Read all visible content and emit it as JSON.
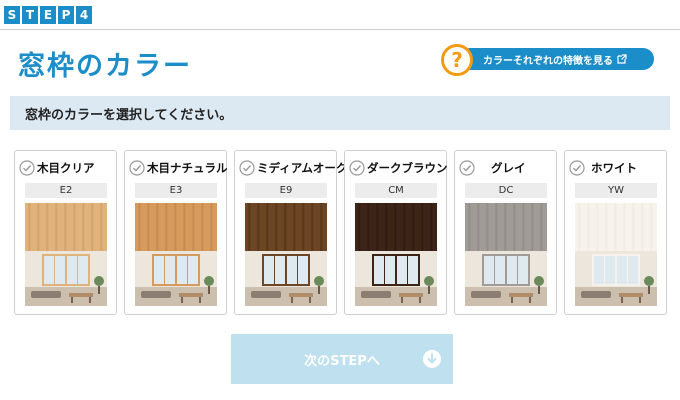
{
  "step": {
    "letters": [
      "S",
      "T",
      "E",
      "P",
      "4"
    ]
  },
  "page": {
    "title": "窓枠のカラー"
  },
  "feature_link": {
    "label": "カラーそれぞれの特徴を見る",
    "help_symbol": "?"
  },
  "instruction": "窓枠のカラーを選択してください。",
  "colors": [
    {
      "name": "木目クリア",
      "code": "E2",
      "swatch_color": "#e0b27c",
      "grain_color": "#d29e65"
    },
    {
      "name": "木目ナチュラル",
      "code": "E3",
      "swatch_color": "#d79a5d",
      "grain_color": "#c4854a"
    },
    {
      "name": "ミディアムオーク",
      "code": "E9",
      "swatch_color": "#6b4524",
      "grain_color": "#553418"
    },
    {
      "name": "ダークブラウン",
      "code": "CM",
      "swatch_color": "#3c2417",
      "grain_color": "#2e1a10"
    },
    {
      "name": "グレイ",
      "code": "DC",
      "swatch_color": "#a09b96",
      "grain_color": "#8e8984"
    },
    {
      "name": "ホワイト",
      "code": "YW",
      "swatch_color": "#f7f3ec",
      "grain_color": "#efe9df"
    }
  ],
  "next_button": {
    "label": "次のSTEPへ"
  },
  "accent_colors": {
    "brand_blue": "#1b8dc8",
    "help_orange": "#f39c12",
    "instruction_bg": "#dce9f3",
    "disabled_button": "#bfe0ee"
  }
}
